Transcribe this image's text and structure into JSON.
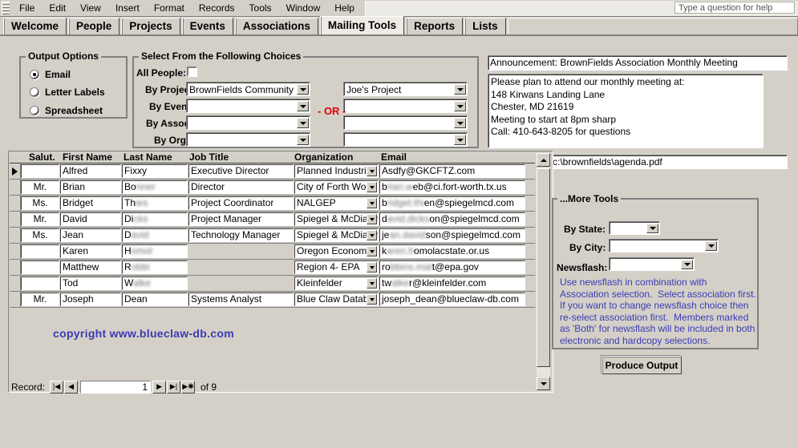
{
  "menu": {
    "items": [
      "File",
      "Edit",
      "View",
      "Insert",
      "Format",
      "Records",
      "Tools",
      "Window",
      "Help"
    ],
    "help_box_placeholder": "Type a question for help"
  },
  "tabs": [
    {
      "label": "Welcome",
      "active": false
    },
    {
      "label": "People",
      "active": false
    },
    {
      "label": "Projects",
      "active": false
    },
    {
      "label": "Events",
      "active": false
    },
    {
      "label": "Associations",
      "active": false
    },
    {
      "label": "Mailing Tools",
      "active": true
    },
    {
      "label": "Reports",
      "active": false
    },
    {
      "label": "Lists",
      "active": false
    }
  ],
  "output_options": {
    "legend": "Output Options",
    "options": [
      {
        "label": "Email",
        "selected": true
      },
      {
        "label": "Letter Labels",
        "selected": false
      },
      {
        "label": "Spreadsheet",
        "selected": false
      }
    ]
  },
  "select_panel": {
    "legend": "Select From the Following Choices",
    "or_label": "- OR -",
    "all_people_label": "All People:",
    "all_people_checked": false,
    "rows": [
      {
        "label": "By Project:",
        "left_value": "BrownFields Community Netw",
        "right_value": "Joe's Project"
      },
      {
        "label": "By Event:",
        "left_value": "",
        "right_value": ""
      },
      {
        "label": "By Assoc:",
        "left_value": "",
        "right_value": ""
      },
      {
        "label": "By Org:",
        "left_value": "",
        "right_value": ""
      }
    ]
  },
  "announcement": {
    "subject": "Announcement: BrownFields Association Monthly Meeting",
    "body": "Please plan to attend our monthly meeting at:\n148 Kirwans Landing Lane\nChester, MD 21619\nMeeting to start at 8pm sharp\nCall: 410-643-8205 for questions",
    "attachment_path": "c:\\brownfields\\agenda.pdf"
  },
  "grid": {
    "columns": [
      "Salut.",
      "First Name",
      "Last Name",
      "Job Title",
      "Organization",
      "Email"
    ],
    "rows": [
      {
        "current": true,
        "salut": "",
        "first": "Alfred",
        "last_visible": "Fixxy",
        "last_hidden": "",
        "title": "Executive Director",
        "org": "Planned Industrial",
        "email_visible": "Asdfy@GKCFTZ.com",
        "email_hidden": ""
      },
      {
        "current": false,
        "salut": "Mr.",
        "first": "Brian",
        "last_visible": "Bo",
        "last_hidden": "nner",
        "title": "Director",
        "org": "City of Forth Worth",
        "email_visible": "b",
        "email_hidden": "rian.w",
        "email_tail": "eb@ci.fort-worth.tx.us"
      },
      {
        "current": false,
        "salut": "Ms.",
        "first": "Bridget",
        "last_visible": "Th",
        "last_hidden": "ies",
        "title": "Project Coordinator",
        "org": "NALGEP",
        "email_visible": "b",
        "email_hidden": "ridget.thi",
        "email_tail": "en@spiegelmcd.com"
      },
      {
        "current": false,
        "salut": "Mr.",
        "first": "David",
        "last_visible": "Di",
        "last_hidden": "cks",
        "title": "Project Manager",
        "org": "Spiegel & McDiarm",
        "email_visible": "d",
        "email_hidden": "avid.dicks",
        "email_tail": "on@spiegelmcd.com"
      },
      {
        "current": false,
        "salut": "Ms.",
        "first": "Jean",
        "last_visible": "D",
        "last_hidden": "avid",
        "title": "Technology Manager",
        "org": "Spiegel & McDiarm",
        "email_visible": "je",
        "email_hidden": "an.david",
        "email_tail": "son@spiegelmcd.com"
      },
      {
        "current": false,
        "salut": "",
        "first": "Karen",
        "last_visible": "H",
        "last_hidden": "omol",
        "title": "",
        "org": "Oregon Economic",
        "email_visible": "k",
        "email_hidden": "aren.h",
        "email_tail": "omolacstate.or.us"
      },
      {
        "current": false,
        "salut": "",
        "first": "Matthew",
        "last_visible": "R",
        "last_hidden": "obbi",
        "title": "",
        "org": "Region 4- EPA",
        "email_visible": "ro",
        "email_hidden": "bbins.mat",
        "email_tail": "t@epa.gov"
      },
      {
        "current": false,
        "salut": "",
        "first": "Tod",
        "last_visible": "W",
        "last_hidden": "alke",
        "title": "",
        "org": "Kleinfelder",
        "email_visible": "tw",
        "email_hidden": "alke",
        "email_tail": "r@kleinfelder.com"
      },
      {
        "current": false,
        "salut": "Mr.",
        "first": "Joseph",
        "last_visible": "Dean",
        "last_hidden": "",
        "title": "Systems Analyst",
        "org": "Blue Claw Databa",
        "email_visible": "joseph_dean@blueclaw-db.com",
        "email_hidden": ""
      }
    ]
  },
  "more_tools": {
    "legend": "...More Tools",
    "fields": [
      {
        "label": "By State:",
        "value": ""
      },
      {
        "label": "By City:",
        "value": ""
      },
      {
        "label": "Newsflash:",
        "value": ""
      }
    ],
    "hint": "Use newsflash in combination with\nAssociation selection.  Select association first.\nIf you want to change newsflash choice then\nre-select association first.  Members marked\nas 'Both' for newsflash will be included in both\nelectronic and hardcopy selections."
  },
  "produce_output_label": "Produce Output",
  "record_nav": {
    "label": "Record:",
    "value": "1",
    "of_label": "of  9"
  },
  "copyright": "copyright www.blueclaw-db.com",
  "colors": {
    "face": "#d4d0c8",
    "accent_blue": "#3b3bb5",
    "or_red": "#e00000"
  }
}
